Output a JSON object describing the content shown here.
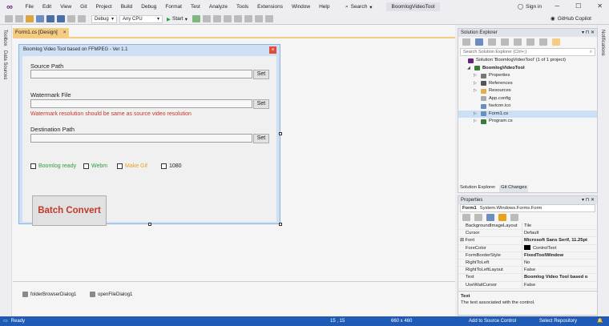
{
  "menu": {
    "items": [
      "File",
      "Edit",
      "View",
      "Git",
      "Project",
      "Build",
      "Debug",
      "Format",
      "Test",
      "Analyze",
      "Tools",
      "Extensions",
      "Window",
      "Help"
    ],
    "search_label": "Search",
    "solution_name": "BoomlogVideoTool",
    "sign_in": "Sign in"
  },
  "toolbar": {
    "config": "Debug",
    "platform": "Any CPU",
    "start_label": "Start",
    "copilot": "GitHub Copilot"
  },
  "left_strip": {
    "toolbox": "Toolbox",
    "data_sources": "Data Sources"
  },
  "right_strip": {
    "notifications": "Notifications"
  },
  "document_tab": {
    "label": "Form1.cs [Design]",
    "close": "×"
  },
  "form": {
    "title": "Boomlog Video Tool based on FFMPEG - Ver 1.1",
    "close": "×",
    "source_label": "Source Path",
    "watermark_label": "Watermark File",
    "watermark_note": "Watermark resolution should be same as source video resolution",
    "destination_label": "Destination Path",
    "set_label": "Set",
    "checkboxes": [
      {
        "label": "Boomlog ready",
        "color": "#2e9e3e"
      },
      {
        "label": "Webm",
        "color": "#2e9e3e"
      },
      {
        "label": "Make Gif",
        "color": "#e8a21e"
      },
      {
        "label": "1080",
        "color": "#222222"
      }
    ],
    "batch_button": "Batch Convert",
    "accent_red": "#c0392b"
  },
  "tray": {
    "components": [
      "folderBrowserDialog1",
      "openFileDialog1"
    ]
  },
  "solution_explorer": {
    "title": "Solution Explorer",
    "search_placeholder": "Search Solution Explorer (Ctrl+;)",
    "tree": [
      {
        "text": "Solution 'BoomlogVideoTool' (1 of 1 project)",
        "indent": 0,
        "icon": "solution-icon",
        "arrow": ""
      },
      {
        "text": "BoomlogVideoTool",
        "indent": 1,
        "icon": "csharp-project-icon",
        "arrow": "◢",
        "bold": true
      },
      {
        "text": "Properties",
        "indent": 2,
        "icon": "wrench-icon",
        "arrow": "▷"
      },
      {
        "text": "References",
        "indent": 2,
        "icon": "references-icon",
        "arrow": "▷"
      },
      {
        "text": "Resources",
        "indent": 2,
        "icon": "folder-icon",
        "arrow": "▷"
      },
      {
        "text": "App.config",
        "indent": 2,
        "icon": "config-icon",
        "arrow": ""
      },
      {
        "text": "favicon.ico",
        "indent": 2,
        "icon": "ico-file-icon",
        "arrow": ""
      },
      {
        "text": "Form1.cs",
        "indent": 2,
        "icon": "form-icon",
        "arrow": "▷",
        "selected": true
      },
      {
        "text": "Program.cs",
        "indent": 2,
        "icon": "csharp-file-icon",
        "arrow": "▷"
      }
    ],
    "tabs": [
      "Solution Explorer",
      "Git Changes"
    ]
  },
  "properties": {
    "title": "Properties",
    "object_name": "Form1",
    "object_type": "System.Windows.Forms.Form",
    "rows": [
      {
        "name": "BackgroundImageLayout",
        "value": "Tile"
      },
      {
        "name": "Cursor",
        "value": "Default"
      },
      {
        "name": "Font",
        "value": "Microsoft Sans Serif, 11.25pt",
        "bold": true,
        "expand": true
      },
      {
        "name": "ForeColor",
        "value": "ControlText",
        "swatch": "#000000"
      },
      {
        "name": "FormBorderStyle",
        "value": "FixedToolWindow",
        "bold": true
      },
      {
        "name": "RightToLeft",
        "value": "No"
      },
      {
        "name": "RightToLeftLayout",
        "value": "False"
      },
      {
        "name": "Text",
        "value": "Boomlog Video Tool based o",
        "bold": true
      },
      {
        "name": "UseWaitCursor",
        "value": "False"
      }
    ],
    "desc_title": "Text",
    "desc_text": "The text associated with the control."
  },
  "status": {
    "ready": "Ready",
    "position": "15 , 15",
    "size": "660 x 460",
    "source_control": "Add to Source Control",
    "repository": "Select Repository",
    "bg": "#1f5bb6"
  }
}
